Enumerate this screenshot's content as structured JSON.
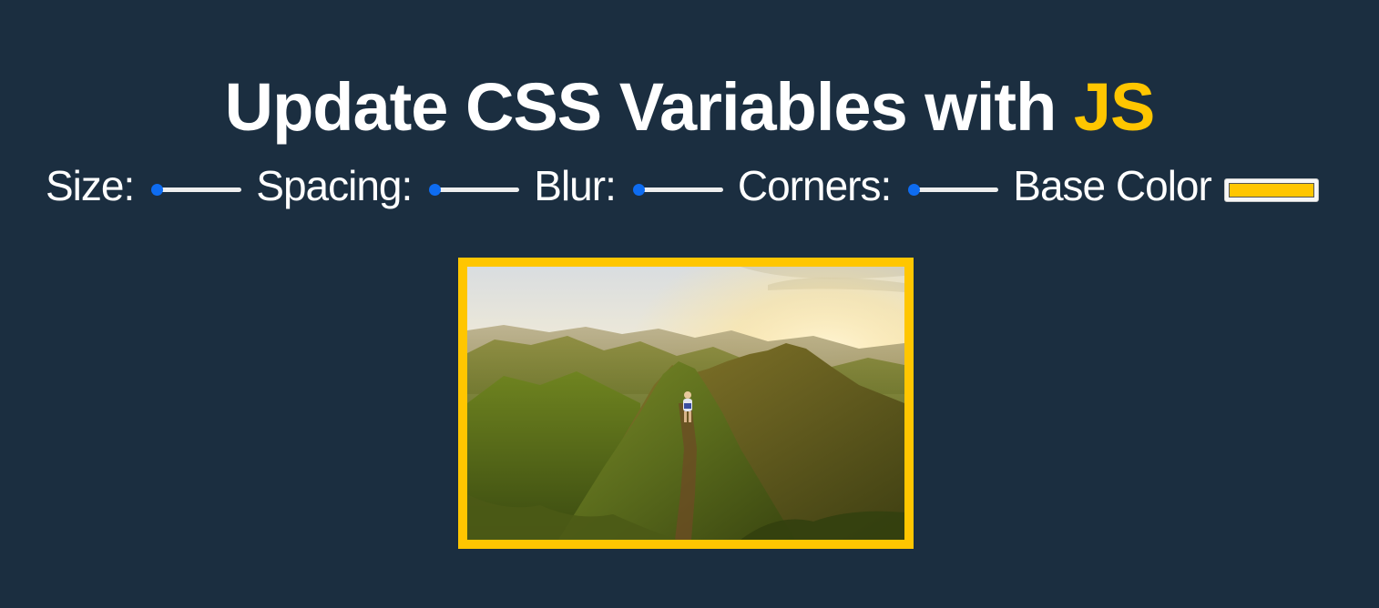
{
  "title": {
    "main": "Update CSS Variables with ",
    "highlight": "JS",
    "highlight_color": "#ffc600"
  },
  "controls": {
    "size": {
      "label": "Size:",
      "value_fraction": 0
    },
    "spacing": {
      "label": "Spacing:",
      "value_fraction": 0
    },
    "blur": {
      "label": "Blur:",
      "value_fraction": 0
    },
    "corners": {
      "label": "Corners:",
      "value_fraction": 0
    },
    "base_color": {
      "label": "Base Color",
      "value": "#ffc600"
    }
  },
  "photo": {
    "icon": "mountain-ridge-hiker-photo",
    "border_color": "#ffc600"
  },
  "colors": {
    "background": "#1b2e40",
    "accent": "#ffc600",
    "slider_thumb": "#0e6cf1"
  }
}
